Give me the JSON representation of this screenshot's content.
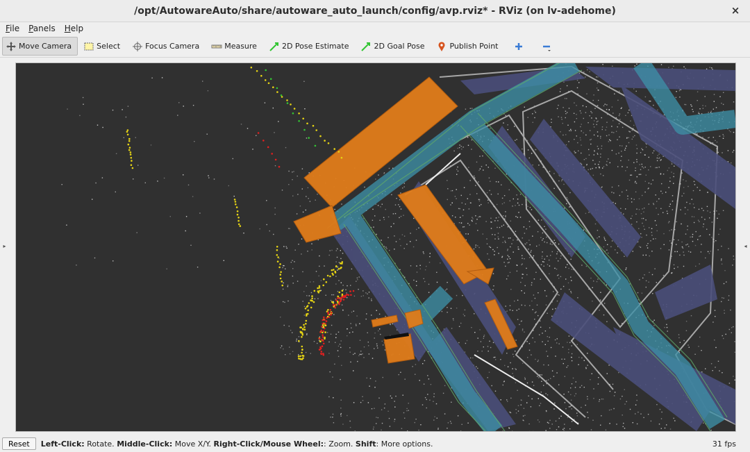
{
  "window": {
    "title": "/opt/AutowareAuto/share/autoware_auto_launch/config/avp.rviz* - RViz (on lv-adehome)",
    "close_glyph": "×"
  },
  "menu": [
    {
      "label": "File",
      "accel": "F",
      "rest": "ile"
    },
    {
      "label": "Panels",
      "accel": "P",
      "rest": "anels"
    },
    {
      "label": "Help",
      "accel": "H",
      "rest": "elp"
    }
  ],
  "toolbar": {
    "move_camera": "Move Camera",
    "select": "Select",
    "focus_camera": "Focus Camera",
    "measure": "Measure",
    "pose_estimate": "2D Pose Estimate",
    "goal_pose": "2D Goal Pose",
    "publish_point": "Publish Point"
  },
  "status": {
    "reset": "Reset",
    "left_click_key": "Left-Click:",
    "left_click_val": " Rotate. ",
    "middle_click_key": "Middle-Click:",
    "middle_click_val": " Move X/Y. ",
    "right_click_key": "Right-Click/Mouse Wheel:",
    "right_click_val": ": Zoom. ",
    "shift_key": "Shift",
    "shift_val": ": More options.",
    "fps": "31 fps"
  },
  "colors": {
    "viewport_bg": "#303030",
    "lane": "#3d8fa6",
    "parking": "#4a4e7a",
    "obstacle": "#e07c1a",
    "points": "#d8d8d8"
  }
}
